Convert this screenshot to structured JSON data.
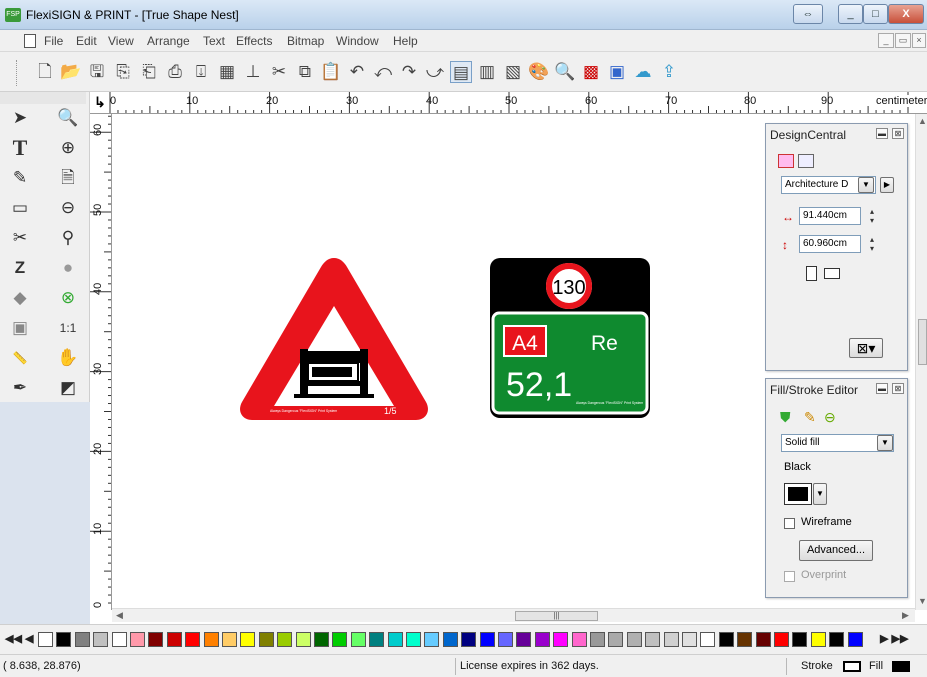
{
  "window": {
    "title": "FlexiSIGN & PRINT - [True Shape Nest]",
    "app_icon_text": "FSP",
    "controls": [
      "⇔",
      "_",
      "□",
      "X"
    ]
  },
  "menu": {
    "items": [
      "File",
      "Edit",
      "View",
      "Arrange",
      "Text",
      "Effects",
      "Bitmap",
      "Window",
      "Help"
    ],
    "mdi_controls": [
      "_",
      "▭",
      "×"
    ]
  },
  "toolbar": {
    "buttons": [
      "new-icon",
      "open-icon",
      "save-icon",
      "import-icon",
      "export-icon",
      "print-icon",
      "plot-icon",
      "production-icon",
      "stamp-icon",
      "cut-icon",
      "copy-icon",
      "paste-icon",
      "undo-icon",
      "undo-all-icon",
      "redo-icon",
      "redo-all-icon",
      "nest-icon",
      "layout-icon",
      "job-icon",
      "color-palette-icon",
      "color-zoom-icon",
      "color-grid-icon",
      "monitor-icon",
      "cloud-icon",
      "cloud-upload-icon"
    ]
  },
  "rulers": {
    "horizontal_labels": [
      "0",
      "10",
      "20",
      "30",
      "40",
      "50",
      "60",
      "70",
      "80",
      "90"
    ],
    "unit": "centimeter",
    "vertical_labels": [
      "60",
      "50",
      "40",
      "30",
      "20",
      "10",
      "0"
    ]
  },
  "canvas": {
    "warning_sign": {
      "caption_left": "Always Dangerous \"FlexiSIGN\" Print System",
      "page_number": "1/5",
      "colors": {
        "border": "#e8141c",
        "inner": "#ffffff",
        "machine": "#000000"
      }
    },
    "road_sign": {
      "speed": "130",
      "route": "A4",
      "destination": "Re",
      "distance": "52,1",
      "caption": "Always Dangerous \"FlexiSIGN\" Print System",
      "colors": {
        "top": "#000000",
        "panel": "#0f8a2f",
        "route_badge": "#e8141c",
        "speed_ring": "#e8141c"
      }
    }
  },
  "design_central": {
    "title": "DesignCentral",
    "preset": "Architecture D",
    "width": "91.440cm",
    "height": "60.960cm"
  },
  "fill_stroke": {
    "title": "Fill/Stroke Editor",
    "fill_type": "Solid fill",
    "color_name": "Black",
    "wireframe_label": "Wireframe",
    "advanced_label": "Advanced...",
    "overprint_label": "Overprint"
  },
  "palette": {
    "nav_left": "◀◀ ◀",
    "nav_right": "▶ ▶▶",
    "colors": [
      "#ffffff",
      "#000000",
      "#808080",
      "#c0c0c0",
      "#ffffff",
      "#ff99aa",
      "#800000",
      "#cc0000",
      "#ff0000",
      "#ff8000",
      "#ffcc66",
      "#ffff00",
      "#808000",
      "#99cc00",
      "#ccff66",
      "#006600",
      "#00cc00",
      "#66ff66",
      "#008080",
      "#00cccc",
      "#00ffcc",
      "#66ccff",
      "#0066cc",
      "#000080",
      "#0000ff",
      "#6666ff",
      "#660099",
      "#9900cc",
      "#ff00ff",
      "#ff66cc",
      "#999999",
      "#aaaaaa",
      "#b0b0b0",
      "#c0c0c0",
      "#d0d0d0",
      "#e0e0e0",
      "#ffffff",
      "#000000",
      "#663300",
      "#660000",
      "#ff0000",
      "#000000",
      "#ffff00",
      "#000000",
      "#0000ff"
    ]
  },
  "status": {
    "coords": "(   8.638,    28.876)",
    "license": "License expires in 362 days.",
    "stroke_label": "Stroke",
    "fill_label": "Fill"
  }
}
